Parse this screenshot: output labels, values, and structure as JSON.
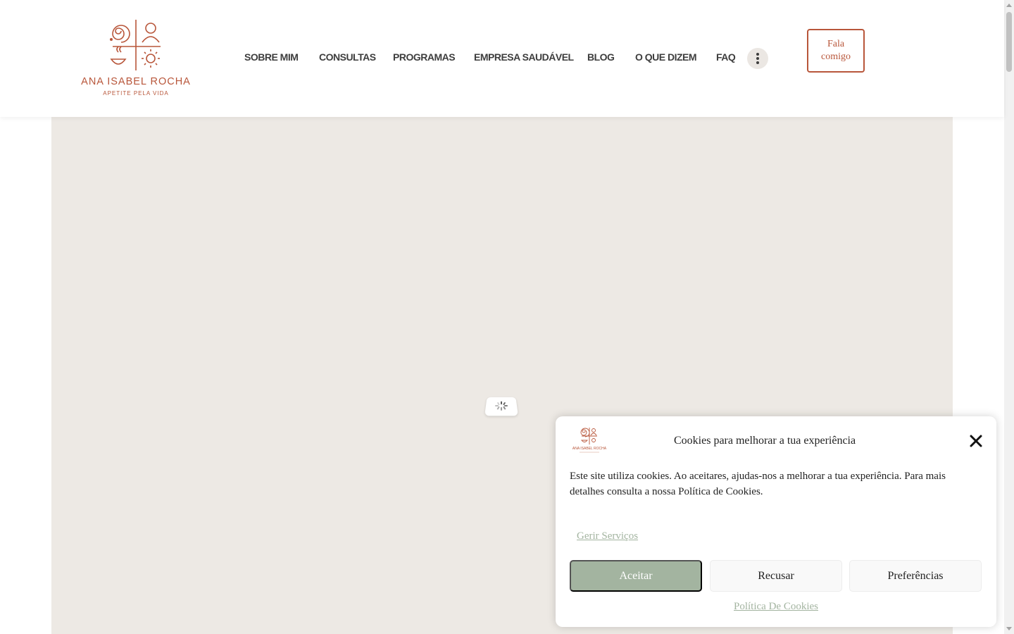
{
  "header": {
    "logo": {
      "name": "ANA ISABEL ROCHA",
      "tagline": "APETITE PELA VIDA"
    },
    "nav": [
      {
        "label": "SOBRE MIM"
      },
      {
        "label": "CONSULTAS"
      },
      {
        "label": "PROGRAMAS"
      },
      {
        "label": "EMPRESA SAUDÁVEL"
      },
      {
        "label": "BLOG"
      },
      {
        "label": "O QUE DIZEM"
      },
      {
        "label": "FAQ"
      }
    ],
    "more_icon": "more-vertical-icon",
    "cta_label": "Fala comigo"
  },
  "main": {
    "loader_icon": "spinner-icon"
  },
  "cookie": {
    "title": "Cookies para melhorar a tua experiência",
    "text": "Este site utiliza cookies. Ao aceitares, ajudas-nos a melhorar a tua experiência. Para mais detalhes consulta a nossa Política de Cookies.",
    "manage_label": "Gerir Serviços",
    "accept_label": "Aceitar",
    "deny_label": "Recusar",
    "prefs_label": "Preferências",
    "policy_label": "Política De Cookies",
    "close_icon": "close-icon"
  },
  "colors": {
    "brand": "#b8563a",
    "accent_green": "#a3b4a0",
    "map_bg": "#ede9e4",
    "text": "#3d3d3d"
  }
}
